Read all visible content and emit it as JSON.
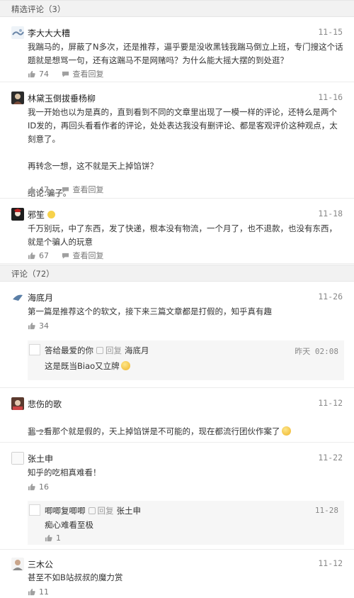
{
  "featured": {
    "header": "精选评论（3）",
    "comments": [
      {
        "user": "李大大大糟",
        "date": "11-15",
        "text": "我踹马的，屏蔽了N多次，还是推荐，逼乎要是没收黑钱我踹马倒立上班，专门搜这个话题就是想骂一句，还有这踹马不是网赌吗？为什么能大摇大摆的到处逛？",
        "likes": "74",
        "view_replies": "查看回复"
      },
      {
        "user": "林黛玉倒拔垂杨柳",
        "date": "11-16",
        "text": "我一开始也以为是真的，直到看到不同的文章里出现了一模一样的评论，还特么是两个ID发的，再回头看看作者的评论，处处表达我没有删评论、都是客观评价这种观点，太刻意了。\n\n再转念一想，这不就是天上掉馅饼？\n\n结论:骗子。",
        "likes": "47",
        "view_replies": "查看回复"
      },
      {
        "user": "邪笙",
        "date": "11-18",
        "text": "千万别玩，中了东西，发了快递，根本没有物流，一个月了，也不退款，也没有东西，就是个骗人的玩意",
        "likes": "67",
        "view_replies": "查看回复"
      }
    ]
  },
  "all": {
    "header": "评论（72）",
    "comments": [
      {
        "user": "海底月",
        "date": "11-26",
        "text": "第一篇是推荐这个的软文，接下来三篇文章都是打假的，知乎真有趣",
        "likes": "34"
      },
      {
        "reply": true,
        "user": "答给最爱的你",
        "reply_word": "回复",
        "reply_to": "海底月",
        "date": "昨天 02:08",
        "text": "这是既当Biao又立牌",
        "likes": ""
      },
      {
        "user": "悲伤的歌",
        "date": "11-12",
        "text": "我一看那个就是假的，天上掉馅饼是不可能的，现在都流行团伙作案了",
        "likes": "21"
      },
      {
        "user": "张土申",
        "date": "11-22",
        "text": "知乎的吃相真难看！",
        "likes": "16"
      },
      {
        "reply": true,
        "user": "唧唧复唧唧",
        "reply_word": "回复",
        "reply_to": "张土申",
        "date": "11-28",
        "text": "痴心难看至极",
        "likes": "1"
      },
      {
        "user": "三木公",
        "date": "11-12",
        "text": "甚至不如B站叔叔的魔力赏",
        "likes": "11"
      }
    ]
  },
  "icons": {
    "like": "thumbs-up-icon",
    "comment": "chat-bubble-icon"
  },
  "colors": {
    "header_bg": "#f2f2f2",
    "text": "#333333",
    "muted": "#888888"
  }
}
